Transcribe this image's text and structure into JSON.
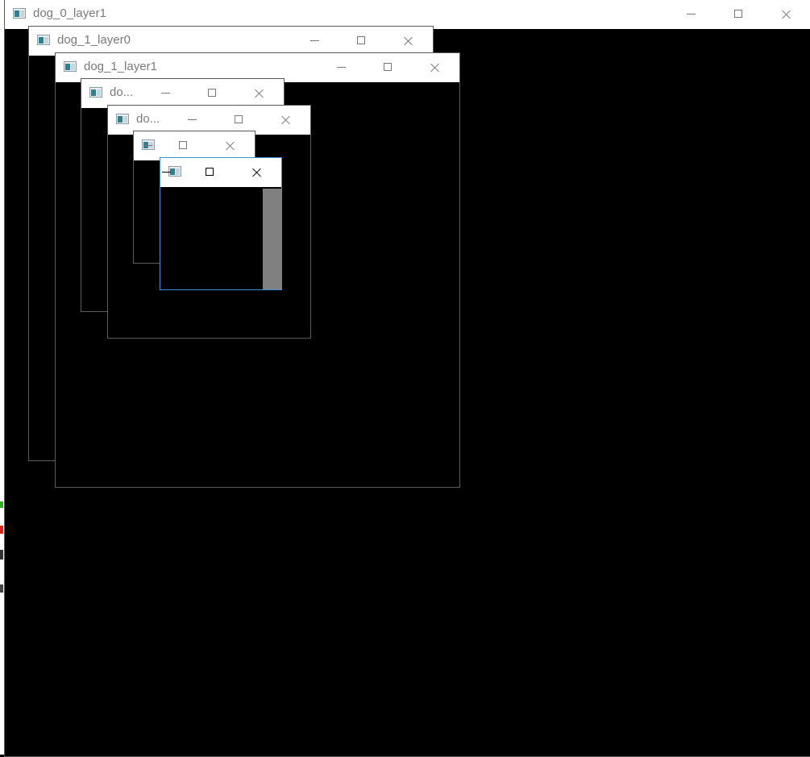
{
  "windows": [
    {
      "title": "dog_0_layer1"
    },
    {
      "title": "dog_1_layer0"
    },
    {
      "title": "dog_1_layer1"
    },
    {
      "title": "do..."
    },
    {
      "title": "do..."
    },
    {
      "title": ""
    },
    {
      "title": ""
    }
  ],
  "colors": {
    "background": "#000000",
    "titlebar": "#ffffff",
    "active_border": "#3f8fd8",
    "inactive_border": "#5a5a5a",
    "image_gray": "#808080"
  },
  "icons": {
    "app": "app-window-icon",
    "minimize": "minimize-icon",
    "maximize": "maximize-icon",
    "close": "close-icon"
  }
}
